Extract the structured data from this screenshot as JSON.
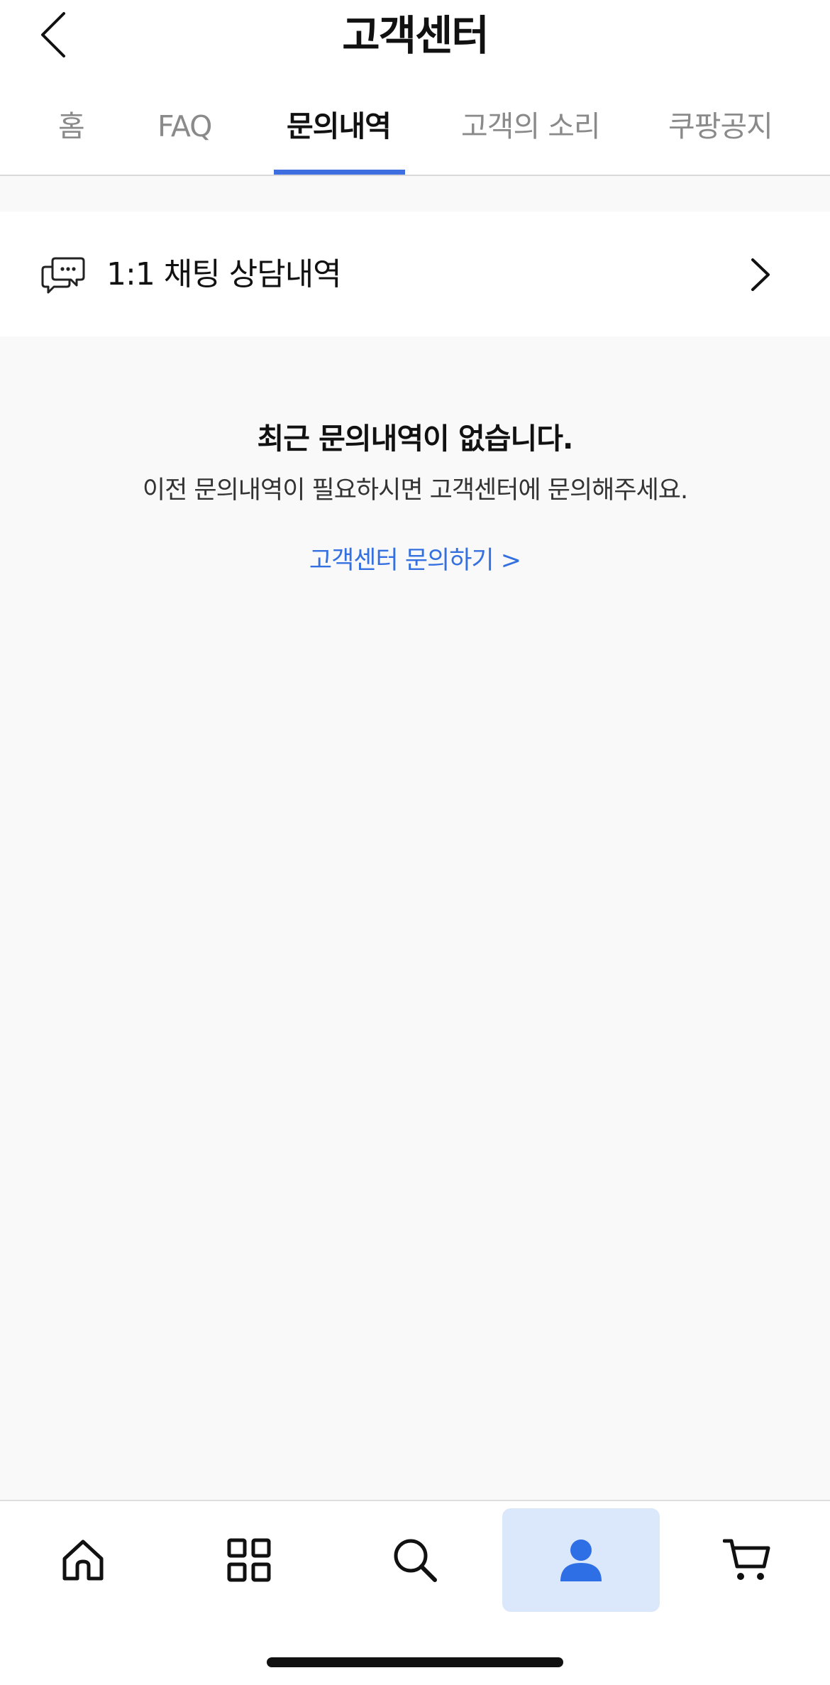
{
  "header": {
    "back_icon": "chevron-left-icon",
    "title": "고객센터"
  },
  "tabs": [
    {
      "label": "홈",
      "active": false
    },
    {
      "label": "FAQ",
      "active": false
    },
    {
      "label": "문의내역",
      "active": true
    },
    {
      "label": "고객의 소리",
      "active": false
    },
    {
      "label": "쿠팡공지",
      "active": false
    }
  ],
  "chat_history": {
    "icon": "chat-bubbles-icon",
    "label": "1:1 채팅 상담내역",
    "arrow_icon": "chevron-right-icon"
  },
  "empty_state": {
    "title": "최근 문의내역이 없습니다.",
    "description": "이전 문의내역이 필요하시면 고객센터에 문의해주세요.",
    "link": "고객센터 문의하기 >"
  },
  "bottom_nav": [
    {
      "name": "home",
      "icon": "home-icon",
      "active": false
    },
    {
      "name": "categories",
      "icon": "grid-icon",
      "active": false
    },
    {
      "name": "search",
      "icon": "search-icon",
      "active": false
    },
    {
      "name": "my",
      "icon": "person-icon",
      "active": true
    },
    {
      "name": "cart",
      "icon": "cart-icon",
      "active": false
    }
  ],
  "colors": {
    "accent": "#3f6ee0",
    "link": "#3470e0",
    "active_nav_bg": "#dbe8fb",
    "background": "#f9f9fa"
  }
}
